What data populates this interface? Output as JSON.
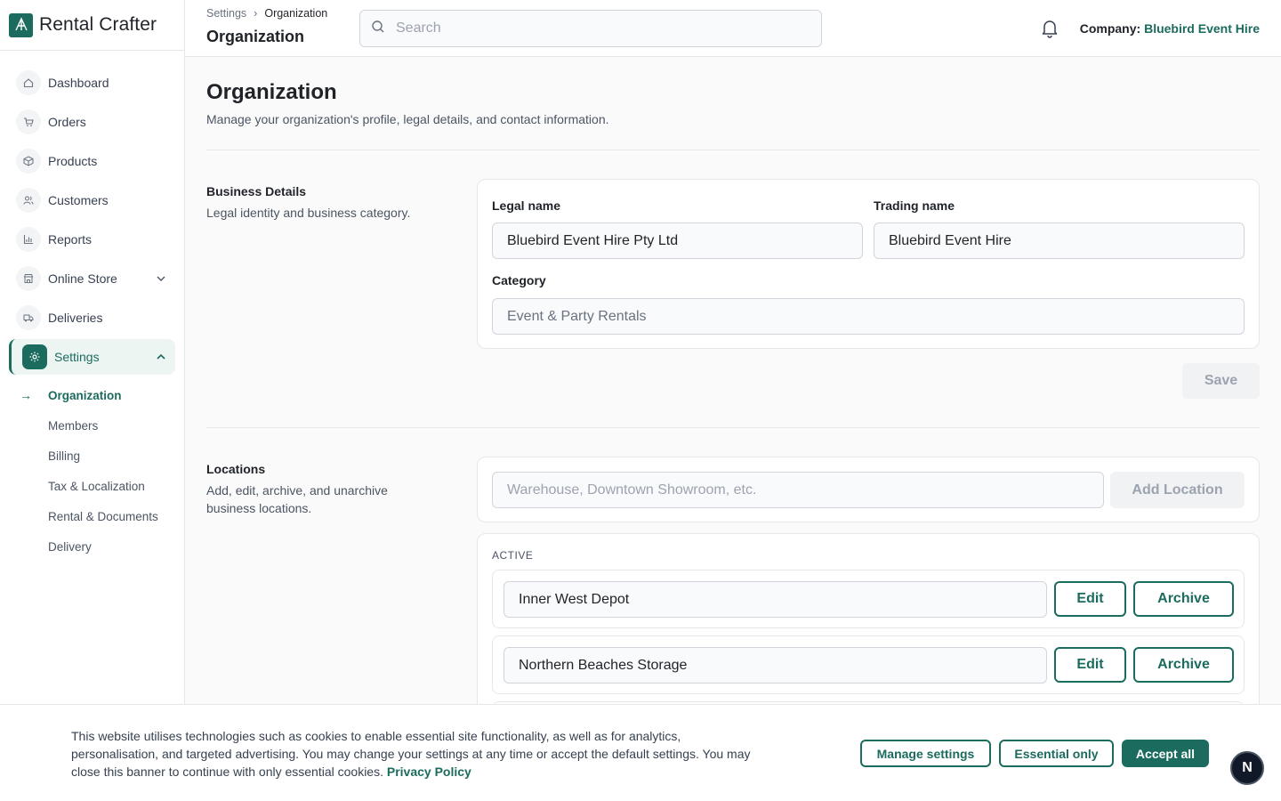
{
  "brand": {
    "name": "Rental Crafter"
  },
  "sidebar": {
    "items": [
      {
        "label": "Dashboard",
        "icon": "home-icon"
      },
      {
        "label": "Orders",
        "icon": "cart-icon"
      },
      {
        "label": "Products",
        "icon": "box-icon"
      },
      {
        "label": "Customers",
        "icon": "users-icon"
      },
      {
        "label": "Reports",
        "icon": "bar-chart-icon"
      },
      {
        "label": "Online Store",
        "icon": "store-icon"
      },
      {
        "label": "Deliveries",
        "icon": "truck-icon"
      },
      {
        "label": "Settings",
        "icon": "gear-icon"
      }
    ],
    "settings_sub": [
      {
        "label": "Organization"
      },
      {
        "label": "Members"
      },
      {
        "label": "Billing"
      },
      {
        "label": "Tax & Localization"
      },
      {
        "label": "Rental & Documents"
      },
      {
        "label": "Delivery"
      }
    ]
  },
  "header": {
    "breadcrumb": [
      "Settings",
      "Organization"
    ],
    "title": "Organization",
    "search_placeholder": "Search",
    "company_label": "Company:",
    "company_value": "Bluebird Event Hire"
  },
  "page": {
    "title": "Organization",
    "subtitle": "Manage your organization's profile, legal details, and contact information."
  },
  "business": {
    "title": "Business Details",
    "subtitle": "Legal identity and business category.",
    "legal_name_label": "Legal name",
    "legal_name_value": "Bluebird Event Hire Pty Ltd",
    "trading_name_label": "Trading name",
    "trading_name_value": "Bluebird Event Hire",
    "category_label": "Category",
    "category_value": "Event & Party Rentals",
    "save_label": "Save"
  },
  "locations": {
    "title": "Locations",
    "subtitle": "Add, edit, archive, and unarchive business locations.",
    "new_placeholder": "Warehouse, Downtown Showroom, etc.",
    "add_label": "Add Location",
    "active_label": "ACTIVE",
    "edit_label": "Edit",
    "archive_label": "Archive",
    "active": [
      {
        "name": "Inner West Depot"
      },
      {
        "name": "Northern Beaches Storage"
      }
    ]
  },
  "cookie": {
    "text": "This website utilises technologies such as cookies to enable essential site functionality, as well as for analytics, personalisation, and targeted advertising. You may change your settings at any time or accept the default settings. You may close this banner to continue with only essential cookies.",
    "link": "Privacy Policy",
    "manage_label": "Manage settings",
    "essential_label": "Essential only",
    "accept_label": "Accept all"
  },
  "badge": {
    "letter": "N"
  },
  "colors": {
    "accent": "#1b6b5e",
    "border": "#e5e7eb",
    "background": "#fafafa"
  }
}
